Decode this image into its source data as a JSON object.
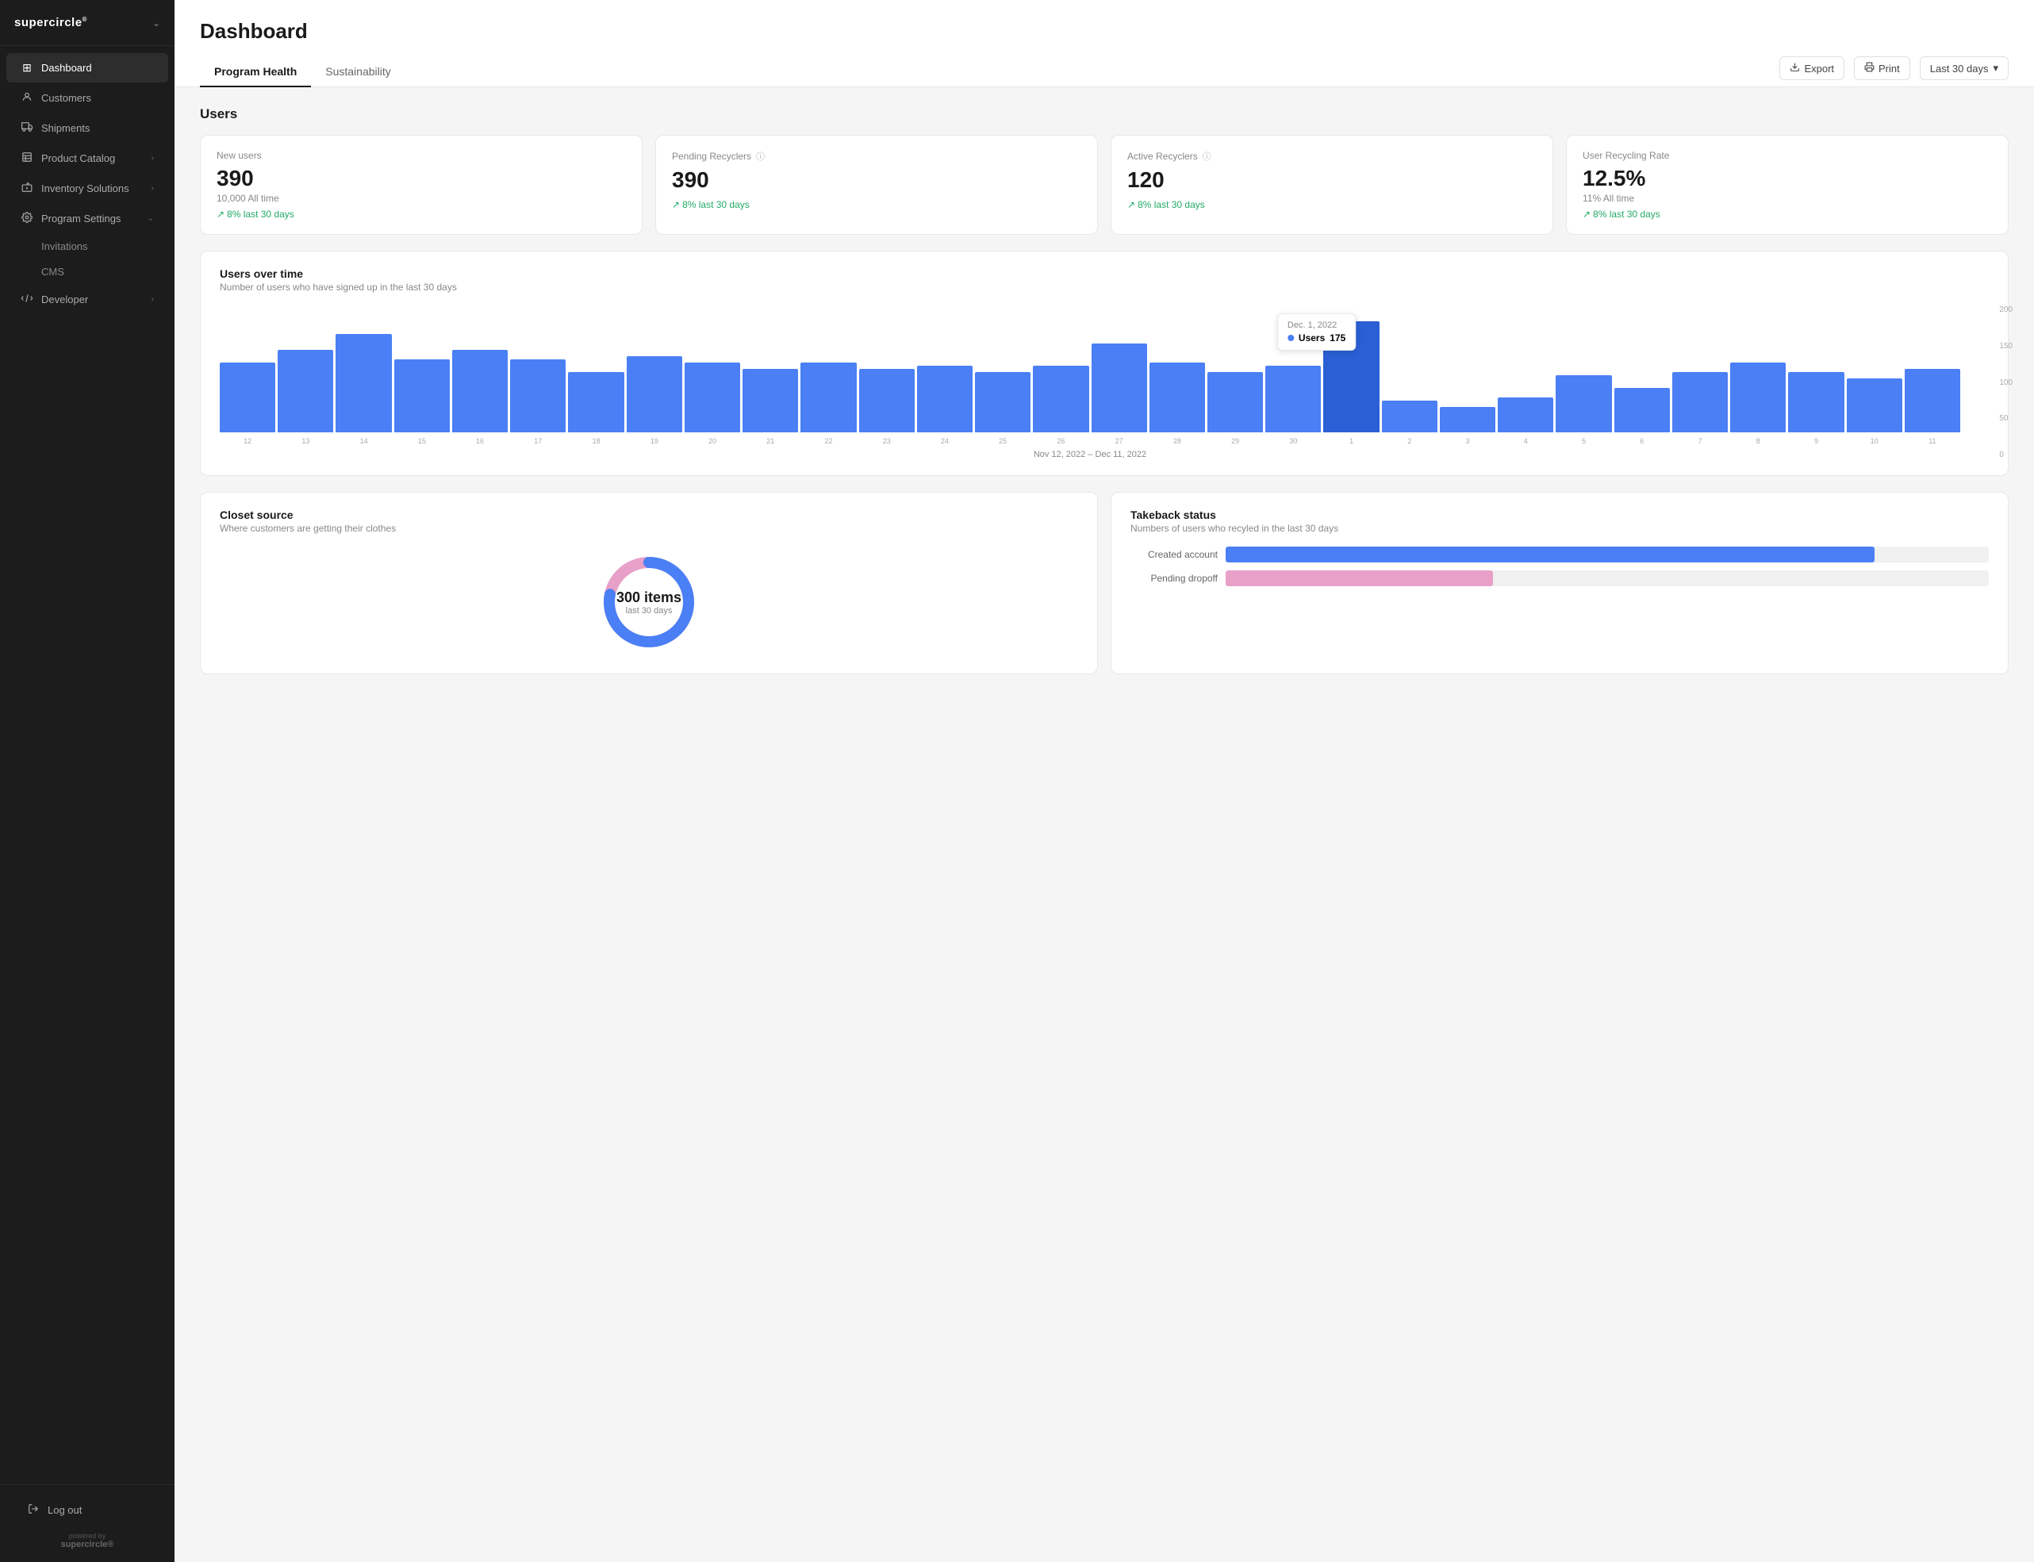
{
  "brand": {
    "name": "supercircle",
    "superscript": "®",
    "powered_by": "powered by",
    "powered_brand": "supercircle®"
  },
  "sidebar": {
    "items": [
      {
        "id": "dashboard",
        "label": "Dashboard",
        "icon": "⊞",
        "active": true,
        "has_chevron": false
      },
      {
        "id": "customers",
        "label": "Customers",
        "icon": "👤",
        "active": false,
        "has_chevron": false
      },
      {
        "id": "shipments",
        "label": "Shipments",
        "icon": "🚚",
        "active": false,
        "has_chevron": false
      },
      {
        "id": "product-catalog",
        "label": "Product Catalog",
        "icon": "📋",
        "active": false,
        "has_chevron": true
      },
      {
        "id": "inventory-solutions",
        "label": "Inventory Solutions",
        "icon": "🗄",
        "active": false,
        "has_chevron": true
      },
      {
        "id": "program-settings",
        "label": "Program Settings",
        "icon": "⚙",
        "active": false,
        "has_chevron": true
      }
    ],
    "sub_items": [
      {
        "id": "invitations",
        "label": "Invitations"
      },
      {
        "id": "cms",
        "label": "CMS"
      }
    ],
    "bottom_items": [
      {
        "id": "developer",
        "label": "Developer",
        "icon": "⛓",
        "has_chevron": true
      }
    ],
    "logout": "Log out"
  },
  "header": {
    "title": "Dashboard",
    "tabs": [
      {
        "id": "program-health",
        "label": "Program Health",
        "active": true
      },
      {
        "id": "sustainability",
        "label": "Sustainability",
        "active": false
      }
    ],
    "actions": {
      "export": "Export",
      "print": "Print",
      "date_range": "Last 30 days"
    }
  },
  "users_section": {
    "title": "Users",
    "stats": [
      {
        "id": "new-users",
        "label": "New users",
        "value": "390",
        "sub": "10,000 All time",
        "trend": "8% last 30 days",
        "has_info": false
      },
      {
        "id": "pending-recyclers",
        "label": "Pending Recyclers",
        "value": "390",
        "sub": "",
        "trend": "8% last 30 days",
        "has_info": true
      },
      {
        "id": "active-recyclers",
        "label": "Active Recyclers",
        "value": "120",
        "sub": "",
        "trend": "8% last 30 days",
        "has_info": true
      },
      {
        "id": "user-recycling-rate",
        "label": "User Recycling Rate",
        "value": "12.5%",
        "sub": "11% All time",
        "trend": "8% last 30 days",
        "has_info": false
      }
    ]
  },
  "chart": {
    "title": "Users over time",
    "subtitle": "Number of users who have signed up in the last 30 days",
    "date_range": "Nov 12, 2022 – Dec 11, 2022",
    "y_labels": [
      "200",
      "150",
      "100",
      "50",
      "0"
    ],
    "x_labels": [
      "12",
      "13",
      "14",
      "15",
      "16",
      "17",
      "18",
      "19",
      "20",
      "21",
      "22",
      "23",
      "24",
      "25",
      "26",
      "27",
      "28",
      "29",
      "30",
      "1",
      "2",
      "3",
      "4",
      "5",
      "6",
      "7",
      "8",
      "9",
      "10",
      "11"
    ],
    "bars": [
      110,
      130,
      155,
      115,
      130,
      115,
      95,
      120,
      110,
      100,
      110,
      100,
      105,
      95,
      105,
      140,
      110,
      95,
      105,
      175,
      50,
      40,
      55,
      90,
      70,
      95,
      110,
      95,
      85,
      100
    ],
    "highlighted_index": 19,
    "tooltip": {
      "date": "Dec. 1, 2022",
      "label": "Users",
      "value": "175"
    },
    "max_value": 200
  },
  "closet_source": {
    "title": "Closet source",
    "subtitle": "Where customers are getting their clothes",
    "center_value": "300 items",
    "center_sub": "last 30 days",
    "donut_segments": [
      {
        "color": "#4a7ff5",
        "percentage": 78
      },
      {
        "color": "#e8a0c8",
        "percentage": 22
      }
    ]
  },
  "takeback_status": {
    "title": "Takeback status",
    "subtitle": "Numbers of users who recyled in the last 30 days",
    "bars": [
      {
        "label": "Created account",
        "value": 85,
        "color": "blue"
      },
      {
        "label": "Pending dropoff",
        "value": 35,
        "color": "pink"
      }
    ]
  }
}
